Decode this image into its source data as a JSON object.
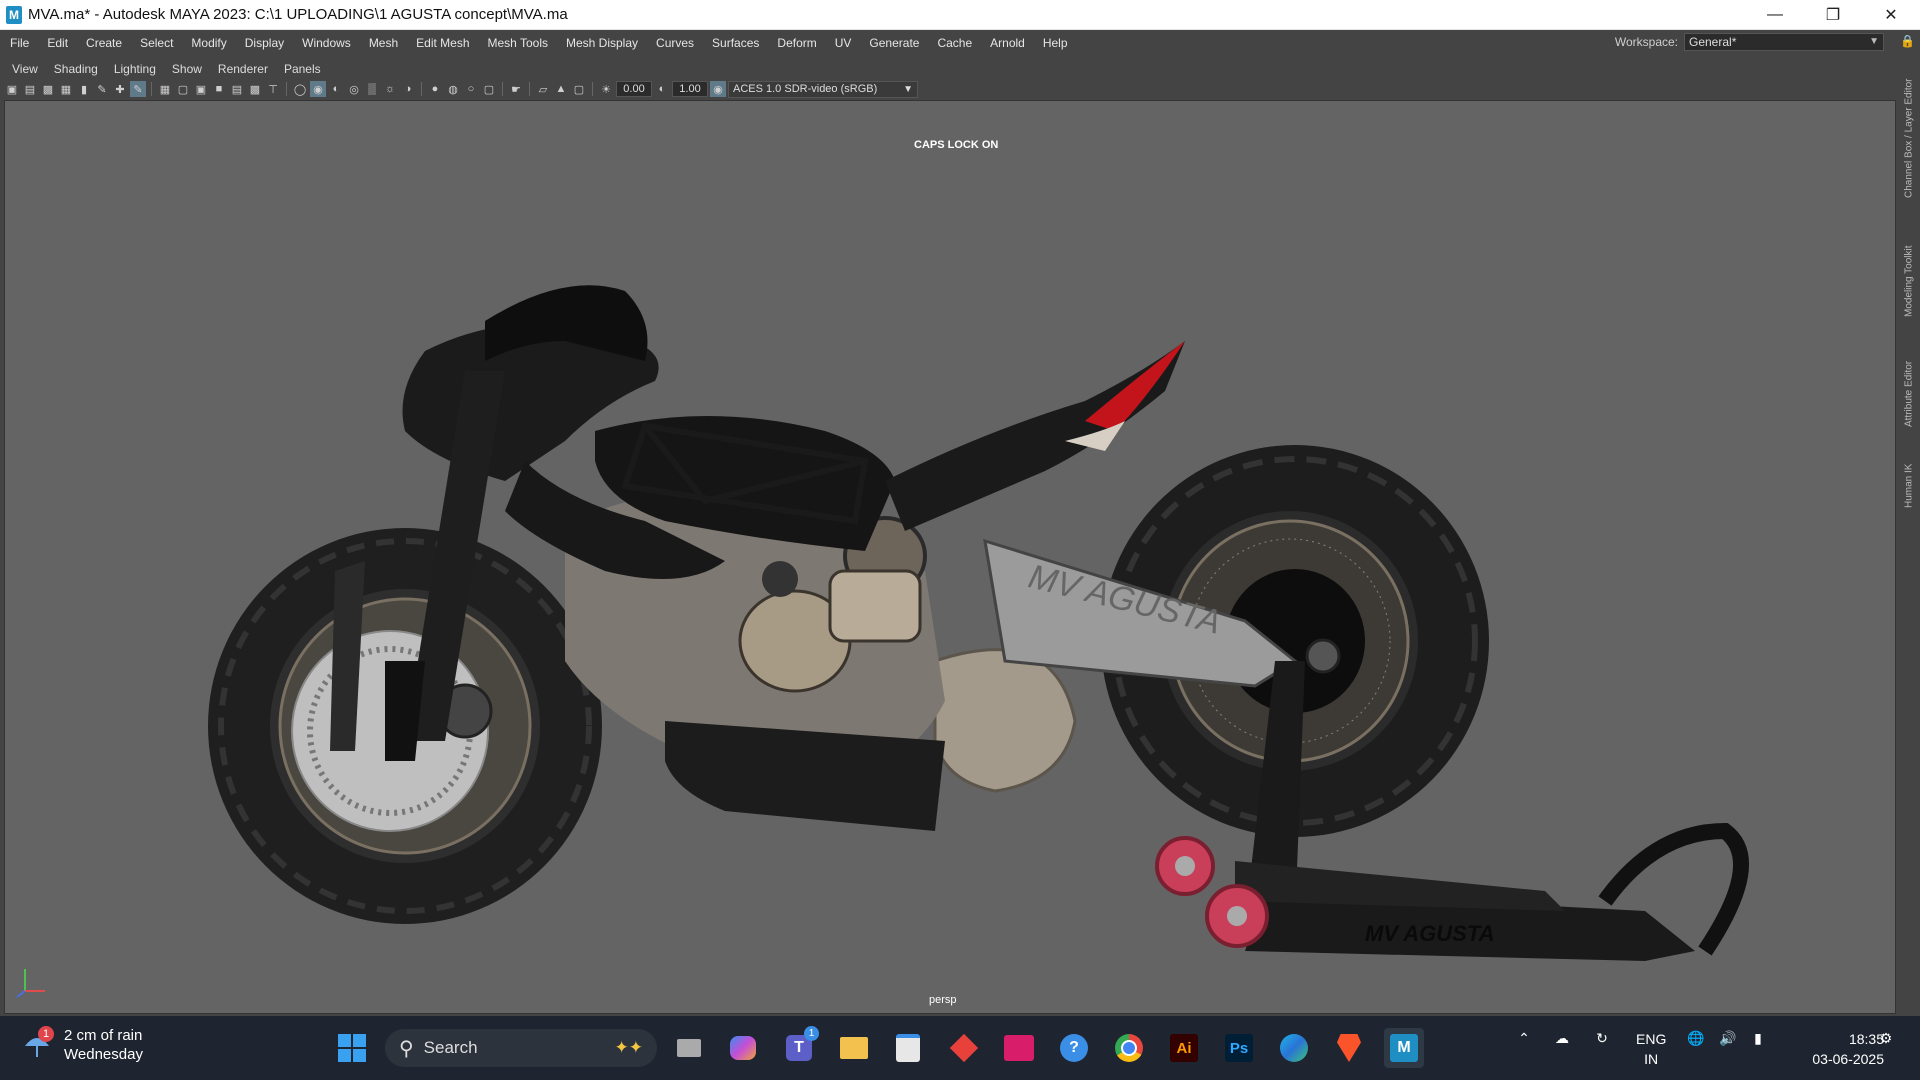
{
  "window": {
    "title": "MVA.ma* - Autodesk MAYA 2023: C:\\1 UPLOADING\\1 AGUSTA concept\\MVA.ma",
    "app_icon_letter": "M"
  },
  "main_menu": [
    "File",
    "Edit",
    "Create",
    "Select",
    "Modify",
    "Display",
    "Windows",
    "Mesh",
    "Edit Mesh",
    "Mesh Tools",
    "Mesh Display",
    "Curves",
    "Surfaces",
    "Deform",
    "UV",
    "Generate",
    "Cache",
    "Arnold",
    "Help"
  ],
  "workspace": {
    "label": "Workspace:",
    "value": "General*"
  },
  "panel_menu": [
    "View",
    "Shading",
    "Lighting",
    "Show",
    "Renderer",
    "Panels"
  ],
  "panel_toolbar": {
    "exposure": "0.00",
    "gamma": "1.00",
    "color_space": "ACES 1.0 SDR-video (sRGB)"
  },
  "viewport": {
    "hud_message": "CAPS LOCK ON",
    "camera": "persp",
    "brand_text": "MV AGUSTA"
  },
  "side_tabs": [
    "Channel Box / Layer Editor",
    "Modeling Toolkit",
    "Attribute Editor",
    "Human IK"
  ],
  "taskbar": {
    "weather_badge": "1",
    "weather_line1": "2 cm of rain",
    "weather_line2": "Wednesday",
    "search_placeholder": "Search",
    "teams_badge": "1",
    "lang_line1": "ENG",
    "lang_line2": "IN",
    "time": "18:35",
    "date": "03-06-2025"
  },
  "colors": {
    "titlebar": "#ffffff",
    "menubar": "#444444",
    "viewport_bg": "#646464",
    "taskbar": "#1f2530",
    "accent_red": "#c3141c"
  }
}
